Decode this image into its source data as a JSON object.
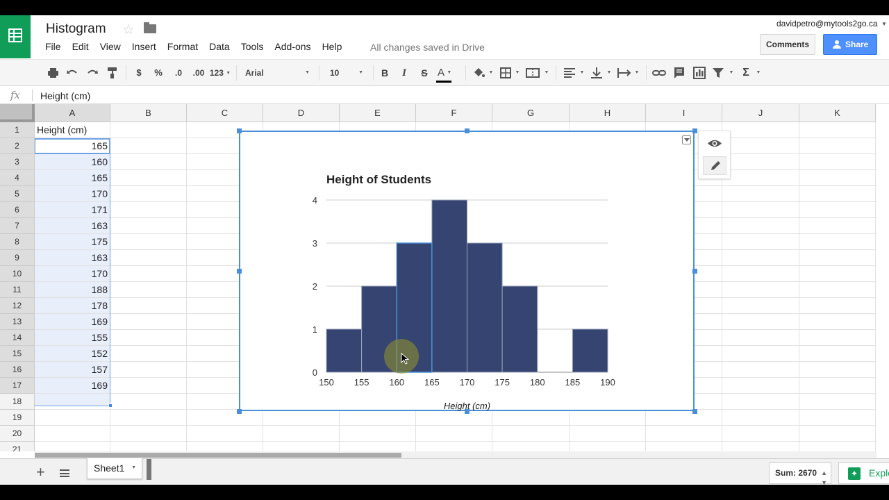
{
  "document": {
    "title": "Histogram",
    "save_status": "All changes saved in Drive"
  },
  "user": {
    "email": "davidpetro@mytools2go.ca"
  },
  "menu": [
    "File",
    "Edit",
    "View",
    "Insert",
    "Format",
    "Data",
    "Tools",
    "Add-ons",
    "Help"
  ],
  "header_buttons": {
    "comments": "Comments",
    "share": "Share"
  },
  "toolbar": {
    "currency": "$",
    "percent": "%",
    "decrease_decimals": ".0",
    "increase_decimals": ".00",
    "more_formats": "123",
    "font": "Arial",
    "font_size": "10",
    "bold": "B",
    "italic": "I",
    "strikethrough": "S",
    "text_color": "A",
    "function": "Σ"
  },
  "formula_bar": {
    "fx": "fx",
    "value": "Height (cm)"
  },
  "columns": [
    "A",
    "B",
    "C",
    "D",
    "E",
    "F",
    "G",
    "H",
    "I",
    "J",
    "K"
  ],
  "rows": [
    "1",
    "2",
    "3",
    "4",
    "5",
    "6",
    "7",
    "8",
    "9",
    "10",
    "11",
    "12",
    "13",
    "14",
    "15",
    "16",
    "17",
    "18",
    "19",
    "20",
    "21"
  ],
  "cells_a": [
    "Height (cm)",
    "165",
    "160",
    "165",
    "170",
    "171",
    "163",
    "175",
    "163",
    "170",
    "188",
    "178",
    "169",
    "155",
    "152",
    "157",
    "169"
  ],
  "chart_data": {
    "type": "bar",
    "title": "Height of Students",
    "xlabel": "Height (cm)",
    "ylabel": "",
    "x_ticks": [
      "150",
      "155",
      "160",
      "165",
      "170",
      "175",
      "180",
      "185",
      "190"
    ],
    "y_ticks": [
      "0",
      "1",
      "2",
      "3",
      "4"
    ],
    "bins": [
      "150-155",
      "155-160",
      "160-165",
      "165-170",
      "170-175",
      "175-180",
      "180-185",
      "185-190"
    ],
    "values": [
      1,
      2,
      3,
      4,
      3,
      2,
      0,
      1
    ],
    "ylim": [
      0,
      4
    ],
    "xlim": [
      150,
      190
    ],
    "grid": true,
    "bar_color": "#354470"
  },
  "sheet_tab": "Sheet1",
  "sum_label": "Sum: 2670",
  "explore_label": "Explore",
  "colors": {
    "brand": "#0f9d58",
    "selection": "#4a90d9",
    "share": "#4d90fe"
  }
}
